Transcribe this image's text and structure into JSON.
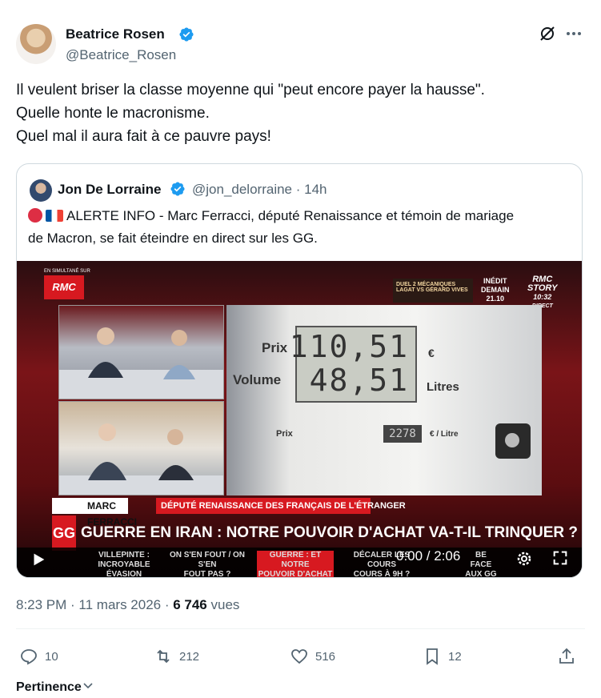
{
  "post": {
    "author": {
      "name": "Beatrice Rosen",
      "handle": "@Beatrice_Rosen"
    },
    "lines": [
      "Il veulent briser la classe moyenne qui \"peut encore payer la hausse\".",
      "Quelle honte le macronisme.",
      "Quel mal il aura fait à ce pauvre pays!"
    ],
    "timestamp": "8:23 PM · 11 mars 2026 · ",
    "views_count": "6 746",
    "views_label": " vues"
  },
  "quote": {
    "author_name": "Jon De Lorraine",
    "meta": "@jon_delorraine · 14h",
    "line1": "ALERTE INFO - Marc Ferracci, député Renaissance et témoin de mariage",
    "line2": "de Macron, se fait éteindre en direct sur les GG."
  },
  "video": {
    "rmc_small": "EN SIMULTANÉ SUR",
    "rmc": "RMC",
    "promo": "DUEL 2 MÉCANIQUES LAGAT VS GÉRARD VIVES",
    "inedit": [
      "INÉDIT",
      "DEMAIN",
      "21.10"
    ],
    "rmc_story": [
      "RMC",
      "STORY",
      "10:32",
      "DIRECT"
    ],
    "pump_prix": "Prix",
    "pump_volume": "Volume",
    "pump_price_value": "110,51",
    "pump_volume_value": "48,51",
    "pump_euro": "€",
    "pump_litres": "Litres",
    "pump_unit_label": "Prix",
    "pump_unit_value": "2278",
    "pump_unit": "€ / Litre",
    "band_name": "MARC FERRACCI",
    "band_sub": "DÉPUTÉ RENAISSANCE DES FRANÇAIS DE L'ÉTRANGER",
    "gg": "GG",
    "headline": "GUERRE EN IRAN : NOTRE POUVOIR D'ACHAT VA-T-IL TRINQUER ?",
    "tickers": [
      "VILLEPINTE :\nINCROYABLE ÉVASION",
      "ON S'EN FOUT / ON S'EN\nFOUT PAS ?",
      "GUERRE : ET NOTRE\nPOUVOIR D'ACHAT ?",
      "DÉCALER LES COURS\nCOURS À 9H ?",
      "BE FACE\nAUX GG"
    ],
    "time": "0:00 / 2:06",
    "progress": 0
  },
  "actions": {
    "replies": "10",
    "reposts": "212",
    "likes": "516",
    "bookmarks": "12"
  },
  "sort_label": "Pertinence",
  "colors": {
    "verified": "#1d9bf0",
    "accent_red": "#d71920",
    "muted": "#536471"
  }
}
